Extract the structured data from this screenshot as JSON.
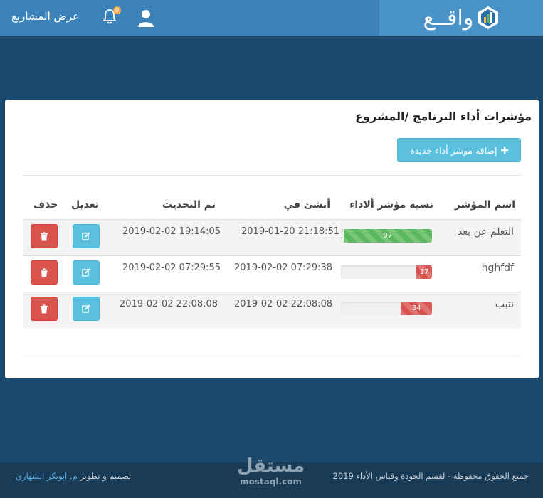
{
  "header": {
    "brand_name": "واقــع",
    "nav_link": "عرض المشاريع",
    "notification_count": "0",
    "colors": {
      "topbar": "#3a82b9",
      "brand_area": "#4a93c8"
    }
  },
  "panel": {
    "title": "مؤشرات أداء البرنامج /المشروع",
    "add_button_label": "إضافه موشر أداء جديدة"
  },
  "table": {
    "columns": {
      "name": "اسم المؤشر",
      "ratio": "نسيه مؤشر ألاداء",
      "created": "أنشئ في",
      "updated": "تم التحديث",
      "edit": "تعديل",
      "delete": "حذف"
    },
    "rows": [
      {
        "name": "التعلم عن بعد",
        "percent": 97,
        "percent_label": "97",
        "status_color": "#5cb85c",
        "created": "2019-01-20 21:18:51",
        "updated": "2019-02-02 19:14:05"
      },
      {
        "name": "hghfdf",
        "percent": 17,
        "percent_label": "17",
        "status_color": "#d9534f",
        "created": "2019-02-02 07:29:38",
        "updated": "2019-02-02 07:29:55"
      },
      {
        "name": "نتبب",
        "percent": 34,
        "percent_label": "34",
        "status_color": "#d9534f",
        "created": "2019-02-02 22:08:08",
        "updated": "2019-02-02 22:08:08"
      }
    ]
  },
  "footer": {
    "rights": "جميع الحقوق محفوظة - لقسم الجودة وقياس الأداء 2019",
    "design_prefix": "تصميم و تطوير",
    "author": "م. ابوبكر الشهاري",
    "watermark_ar": "مستقل",
    "watermark_en": "mostaql.com"
  }
}
